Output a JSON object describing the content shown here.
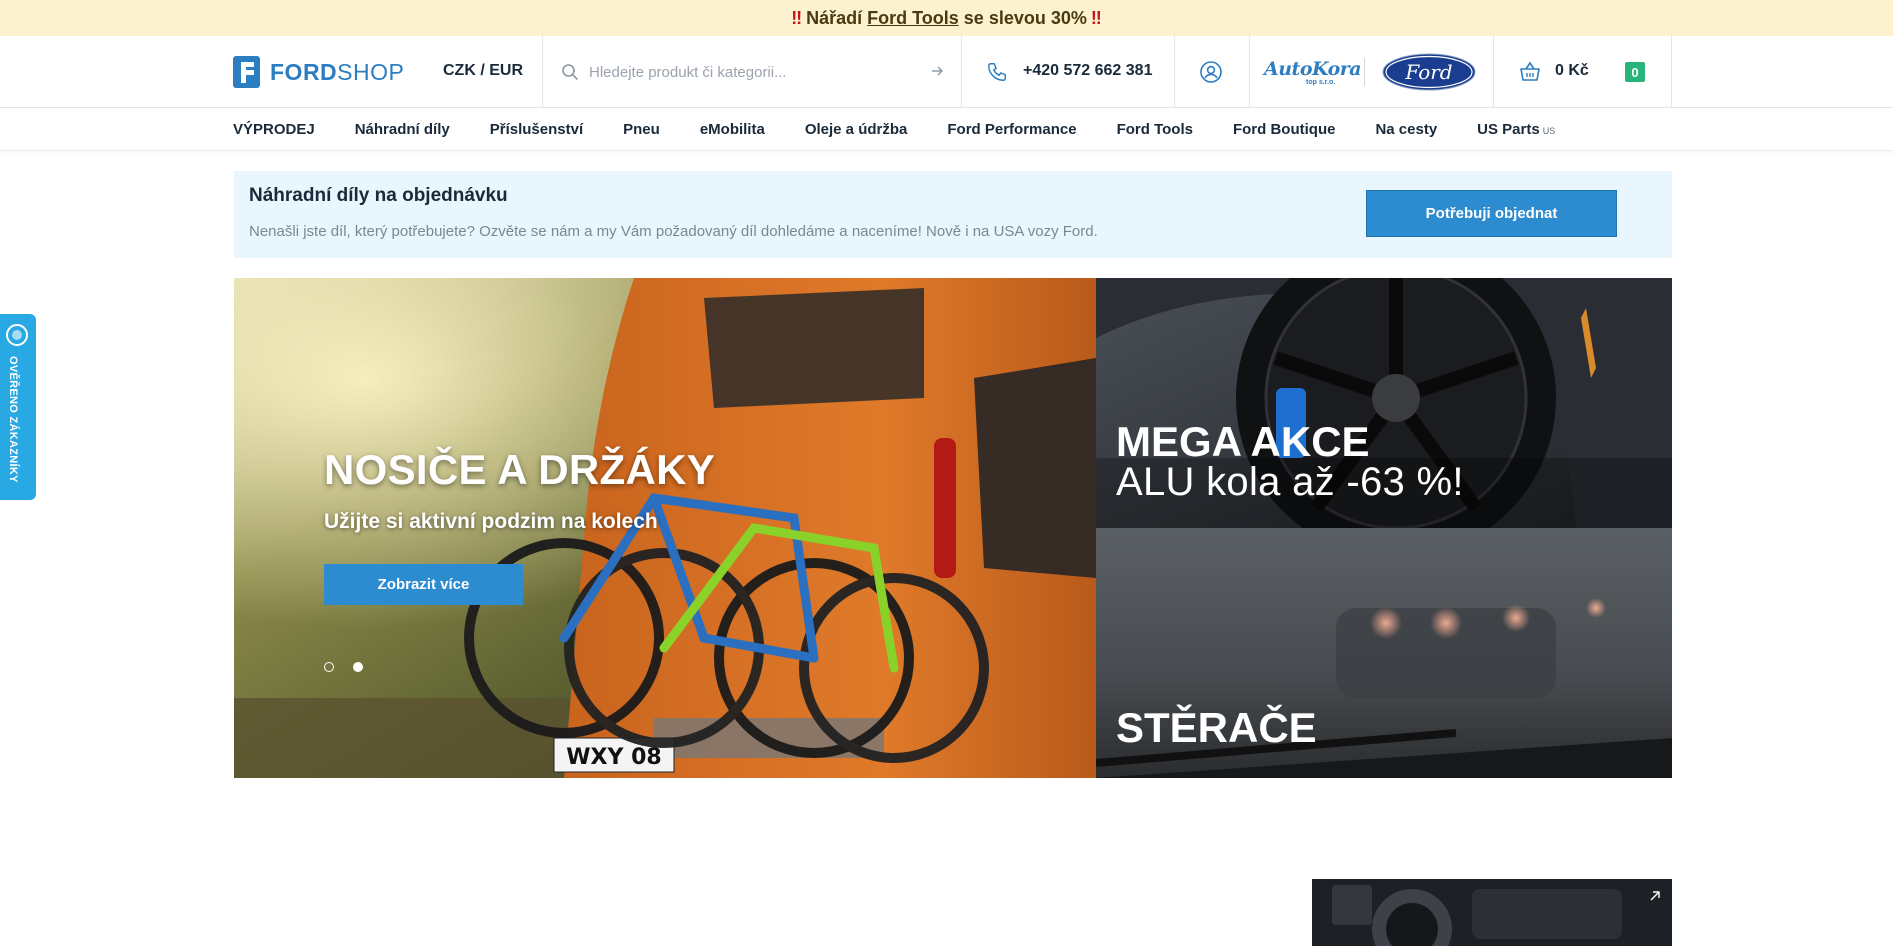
{
  "promo": {
    "prefix": "Nářadí",
    "link": "Ford Tools",
    "suffix": "se slevou 30%"
  },
  "header": {
    "logo_bold": "FORD",
    "logo_light": "SHOP",
    "currency": "CZK / EUR",
    "search_placeholder": "Hledejte produkt či kategorii...",
    "phone": "+420 572 662 381",
    "brand_autokora": "Auto",
    "brand_autokora_b": "Kora",
    "brand_autokora_sub": "top s.r.o.",
    "brand_ford": "Ford",
    "cart_price": "0 Kč",
    "cart_count": "0"
  },
  "nav": {
    "items": [
      "VÝPRODEJ",
      "Náhradní díly",
      "Příslušenství",
      "Pneu",
      "eMobilita",
      "Oleje a údržba",
      "Ford Performance",
      "Ford Tools",
      "Ford Boutique",
      "Na cesty"
    ],
    "us_parts": "US Parts",
    "us_parts_sub": "US"
  },
  "order_banner": {
    "title": "Náhradní díly na objednávku",
    "description": "Nenašli jste díl, který potřebujete? Ozvěte se nám a my Vám požadovaný díl dohledáme a naceníme! Nově i na USA vozy Ford.",
    "button": "Potřebuji objednat"
  },
  "hero": {
    "title": "NOSIČE A DRŽÁKY",
    "subtitle": "Užijte si aktivní podzim na kolech",
    "button": "Zobrazit více",
    "plate": "WXY 08",
    "slides": 2,
    "active_slide": 2
  },
  "tiles": {
    "first_title": "MEGA AKCE",
    "first_subtitle": "ALU kola až -63 %!",
    "second_title": "STĚRAČE"
  },
  "side_widget": {
    "label": "OVĚŘENO ZÁKAZNÍKY"
  },
  "colors": {
    "brand_blue": "#2d7dc1",
    "button_blue": "#2d8bd0",
    "promo_bg": "#fdf2cf",
    "banner_bg": "#eaf6fd",
    "cart_badge": "#27b57a",
    "widget_blue": "#28a9e3"
  }
}
